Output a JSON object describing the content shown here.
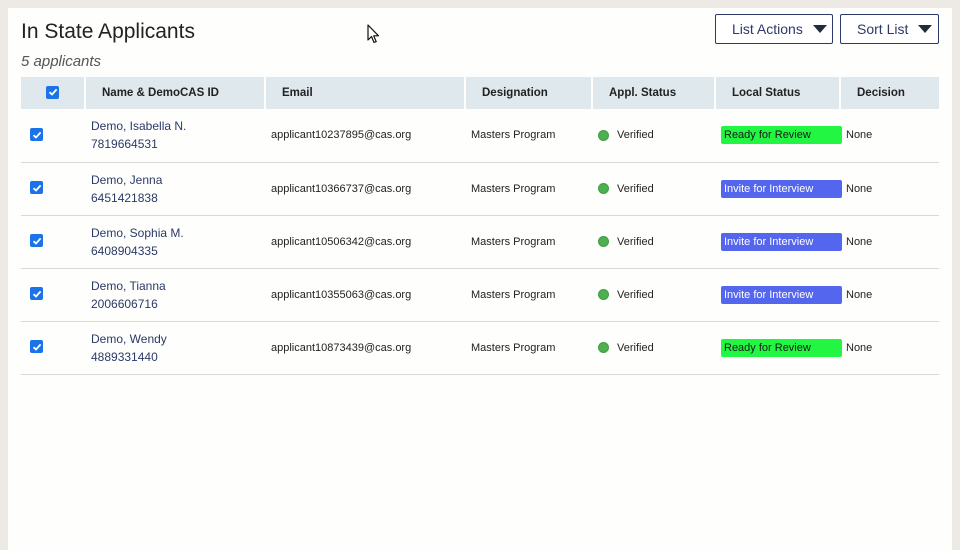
{
  "header": {
    "title": "In State Applicants",
    "subtitle": "5 applicants",
    "list_actions_label": "List Actions",
    "sort_list_label": "Sort List"
  },
  "table": {
    "columns": [
      "Name & DemoCAS ID",
      "Email",
      "Designation",
      "Appl. Status",
      "Local Status",
      "Decision"
    ],
    "rows": [
      {
        "name": "Demo, Isabella N.",
        "id": "7819664531",
        "email": "applicant10237895@cas.org",
        "designation": "Masters Program",
        "appl_status": "Verified",
        "local_status": "Ready for Review",
        "local_status_kind": "ready",
        "decision": "None"
      },
      {
        "name": "Demo, Jenna",
        "id": "6451421838",
        "email": "applicant10366737@cas.org",
        "designation": "Masters Program",
        "appl_status": "Verified",
        "local_status": "Invite for Interview",
        "local_status_kind": "invite",
        "decision": "None"
      },
      {
        "name": "Demo, Sophia M.",
        "id": "6408904335",
        "email": "applicant10506342@cas.org",
        "designation": "Masters Program",
        "appl_status": "Verified",
        "local_status": "Invite for Interview",
        "local_status_kind": "invite",
        "decision": "None"
      },
      {
        "name": "Demo, Tianna",
        "id": "2006606716",
        "email": "applicant10355063@cas.org",
        "designation": "Masters Program",
        "appl_status": "Verified",
        "local_status": "Invite for Interview",
        "local_status_kind": "invite",
        "decision": "None"
      },
      {
        "name": "Demo, Wendy",
        "id": "4889331440",
        "email": "applicant10873439@cas.org",
        "designation": "Masters Program",
        "appl_status": "Verified",
        "local_status": "Ready for Review",
        "local_status_kind": "ready",
        "decision": "None"
      }
    ]
  },
  "colors": {
    "ready": "#22f542",
    "invite": "#5566ee",
    "verified_dot": "#4caf50",
    "header_bg": "#dfe8ed",
    "link": "#2b3a67"
  },
  "icons": {
    "checkbox": "checkbox-checked-icon",
    "caret": "caret-down-icon",
    "cursor": "mouse-pointer-icon",
    "status": "status-dot-icon"
  }
}
